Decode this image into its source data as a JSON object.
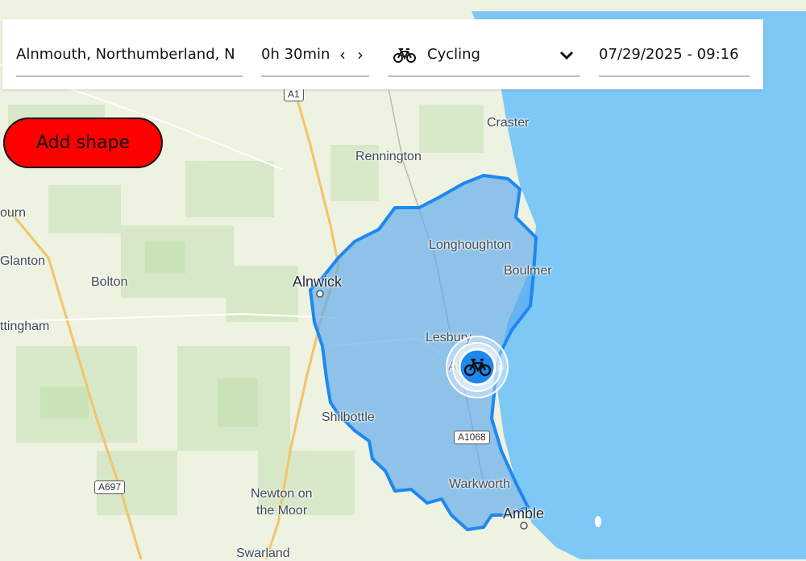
{
  "search": {
    "location": "Alnmouth, Northumberland, N",
    "duration": "0h 30min",
    "mode_label": "Cycling",
    "mode_icon": "bicycle-icon",
    "datetime": "07/29/2025 - 09:16"
  },
  "actions": {
    "add_shape_label": "Add shape"
  },
  "map": {
    "places": {
      "craster": "Craster",
      "rennington": "Rennington",
      "longhoughton": "Longhoughton",
      "boulmer": "Boulmer",
      "alnwick": "Alnwick",
      "bolton": "Bolton",
      "glanton": "Glanton",
      "ourn": "ourn",
      "ttingham": "ttingham",
      "lesbury": "Lesbury",
      "alnmouth": "Alnmouth",
      "shilbottle": "Shilbottle",
      "warkworth": "Warkworth",
      "amble": "Amble",
      "newton": "Newton on",
      "newton2": "the Moor",
      "swarland": "Swarland"
    },
    "roads": {
      "a1": "A1",
      "a1068": "A1068",
      "a697": "A697"
    },
    "colors": {
      "sea": "#7ec8f6",
      "land": "#eef2e0",
      "isochrone_fill": "#5aa8ee",
      "isochrone_stroke": "#1e88f0",
      "button": "#ff0000"
    }
  }
}
